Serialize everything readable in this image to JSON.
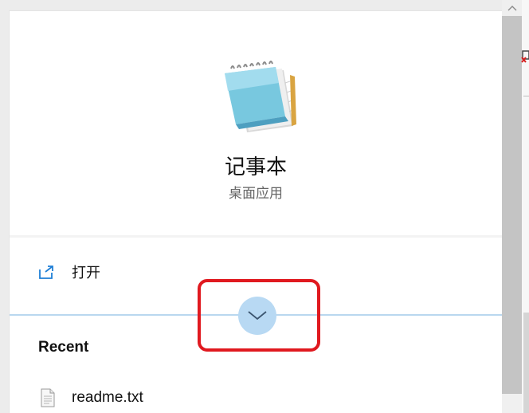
{
  "app": {
    "name": "记事本",
    "type": "桌面应用",
    "icon": "notepad-icon"
  },
  "actions": {
    "open_label": "打开",
    "open_icon": "open-external-icon",
    "expand_icon": "chevron-down-icon"
  },
  "recent": {
    "heading": "Recent",
    "items": [
      {
        "label": "readme.txt",
        "icon": "text-file-icon"
      }
    ]
  },
  "colors": {
    "accent_light": "#b8d9f3",
    "accent_line": "#b9d7ef",
    "open_icon_blue": "#1f7fd6",
    "highlight_red": "#e0191f",
    "scroll_thumb": "#c4c4c4"
  }
}
